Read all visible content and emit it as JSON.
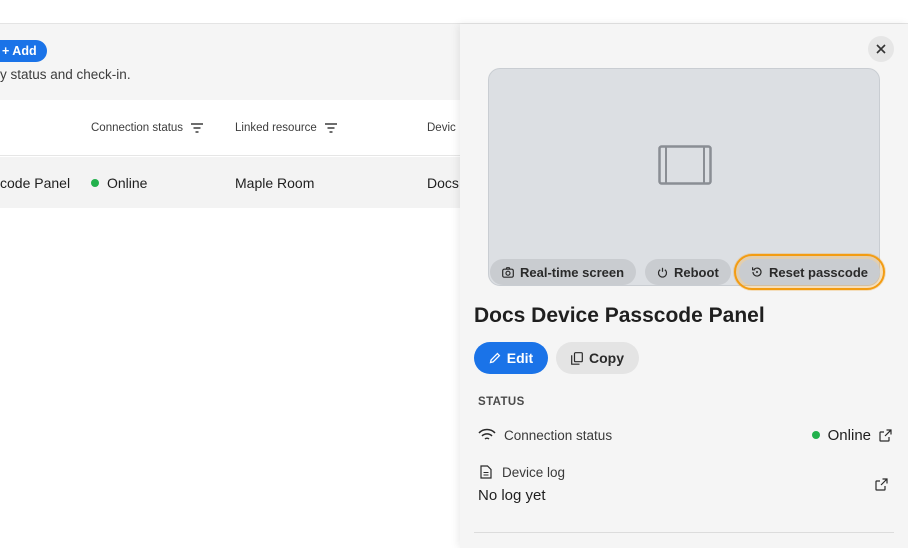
{
  "main": {
    "add_label": "+ Add",
    "subtitle": "y status and check-in.",
    "columns": [
      {
        "label": ""
      },
      {
        "label": "Connection status"
      },
      {
        "label": "Linked resource"
      },
      {
        "label": "Devic"
      }
    ],
    "rows": [
      {
        "name": "code Panel",
        "status": "Online",
        "resource": "Maple Room",
        "device": "Docs"
      }
    ]
  },
  "panel": {
    "preview_actions": [
      {
        "label": "Real-time screen",
        "icon": "camera-icon"
      },
      {
        "label": "Reboot",
        "icon": "power-icon"
      },
      {
        "label": "Reset passcode",
        "icon": "reset-icon"
      }
    ],
    "title": "Docs Device Passcode Panel",
    "edit_label": "Edit",
    "copy_label": "Copy",
    "status_section": "STATUS",
    "connection_label": "Connection status",
    "connection_value": "Online",
    "device_log_label": "Device log",
    "device_log_value": "No log yet"
  },
  "colors": {
    "accent": "#1a73e8",
    "online": "#22b14c",
    "highlight": "#f39c12"
  }
}
